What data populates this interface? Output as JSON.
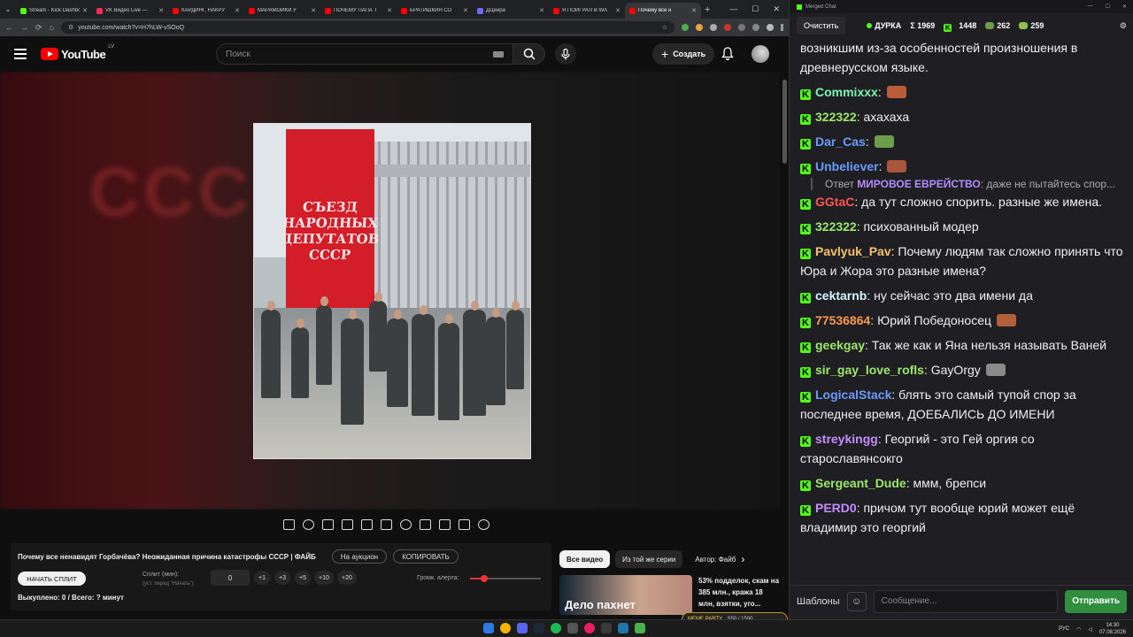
{
  "browser": {
    "tabs": [
      {
        "label": "Stream - Kick Dashboard",
        "color": "#53fc18"
      },
      {
        "label": "VK Видео Live — ",
        "color": "#ff2d55"
      },
      {
        "label": "КАРДИНГ, НАКРУ",
        "color": "#ff0000"
      },
      {
        "label": "МАРАМОЙКИ У",
        "color": "#ff0000"
      },
      {
        "label": "ПОЧЕМУ ПАПА Т",
        "color": "#ff0000"
      },
      {
        "label": "БРАТИШКИН СО",
        "color": "#ff0000"
      },
      {
        "label": "ДЦейра",
        "color": "#6b6bff"
      },
      {
        "label": "Я ПОИГРАЛ В WA",
        "color": "#ff0000"
      },
      {
        "label": "Почему все н",
        "color": "#ff0000",
        "active": true
      }
    ],
    "url": "youtube.com/watch?v=H7hLW-vSOoQ"
  },
  "youtube": {
    "logo_text": "YouTube",
    "region": "LV",
    "search_placeholder": "Поиск",
    "create_label": "Создать"
  },
  "frame": {
    "banner_lines": [
      "СЪЕЗД",
      "НАРОДНЫХ",
      "ДЕПУТАТОВ",
      "СССР"
    ],
    "background_text": "СССР"
  },
  "panel": {
    "title": "Почему все ненавидят Горбачёва? Неожиданная причина катастрофы СССР | ФАЙБ",
    "auction_label": "На аукцион",
    "copy_label": "КОПИРОВАТЬ",
    "start_split": "НАЧАТЬ СПЛИТ",
    "split_label": "Сплит (мин):",
    "split_hint": "(уст. перед \"Начать\")",
    "split_value": "0",
    "increments": [
      "+1",
      "+3",
      "+5",
      "+10",
      "+20"
    ],
    "alert_label": "Громк. алерта:",
    "alert_volume": 0.2,
    "bought": "Выкуплено: 0 / Всего: ? минут"
  },
  "related": {
    "chips": [
      "Все видео",
      "Из той же серии",
      "Автор: Файб"
    ],
    "thumb_text": "Дело пахнет",
    "video_title": "53% подделок, скам на 385 млн., кража 18 млн, взятки, уго..."
  },
  "chat": {
    "window_title": "Merged Chat",
    "clear_label": "Очистить",
    "channel": "ДУРКА",
    "stats": [
      {
        "icon": "sigma-icon",
        "value": "Σ 1969"
      },
      {
        "icon": "kick-icon",
        "value": "1448"
      },
      {
        "icon": "frog-icon",
        "value": "262"
      },
      {
        "icon": "frog2-icon",
        "value": "259"
      }
    ],
    "first_line": "возникшим из-за особенностей произношения в древнерусском языке.",
    "messages": [
      {
        "nick": "Commixxx",
        "color": "#7cf5b0",
        "text": "",
        "emote": "#b85c3a"
      },
      {
        "nick": "322322",
        "color": "#9be86b",
        "text": "ахахаха"
      },
      {
        "nick": "Dar_Cas",
        "color": "#6a9cff",
        "text": "",
        "emote": "#6d9c4a"
      },
      {
        "nick": "Unbeliever",
        "color": "#6a9cff",
        "text": "",
        "emote": "#a8553c"
      },
      {
        "reply_prefix": "Ответ",
        "reply_nick": "МИРОВОЕ ЕВРЕЙСТВО",
        "reply_text": "даже не пытайтесь спор..."
      },
      {
        "nick": "GGtaC",
        "color": "#ff5252",
        "text": "да тут сложно спорить. разные же имена."
      },
      {
        "nick": "322322",
        "color": "#9be86b",
        "text": "психованный модер"
      },
      {
        "nick": "Pavlyuk_Pav",
        "color": "#f5c26b",
        "text": "Почему людям так сложно принять что Юра и Жора это разные имена?"
      },
      {
        "nick": "cektarnb",
        "color": "#d6f5ff",
        "text": "ну сейчас это два имени да"
      },
      {
        "nick": "77536864",
        "color": "#ff9b4a",
        "text": "Юрий Победоносец",
        "emote": "#b0613c"
      },
      {
        "nick": "geekgay",
        "color": "#9be86b",
        "text": "Так же как и Яна нельзя называть Ваней"
      },
      {
        "nick": "sir_gay_love_rofls",
        "color": "#9be86b",
        "text": "GayOrgy",
        "emote": "#8a8a8a"
      },
      {
        "nick": "LogicalStack",
        "color": "#6a9cff",
        "text": "блять это самый тупой спор за последнее время, ДОЕБАЛИСЬ ДО ИМЕНИ"
      },
      {
        "nick": "streykingg",
        "color": "#c88bff",
        "text": "Георгий - это Гей оргия со старославянсокго"
      },
      {
        "nick": "Sergeant_Dude",
        "color": "#9be86b",
        "text": "ммм, брепси"
      },
      {
        "nick": "PERD0",
        "color": "#c88bff",
        "text": "причом тут вообще юрий может ещё владимир это георгий"
      }
    ],
    "templates_label": "Шаблоны",
    "input_placeholder": "Сообщение...",
    "send_label": "Отправить"
  },
  "taskbar": {
    "lang": "РУС",
    "time": "14:30",
    "date": "07.08.2026",
    "party_label": "MEME PARTY",
    "party_value": "550 / 1500"
  }
}
